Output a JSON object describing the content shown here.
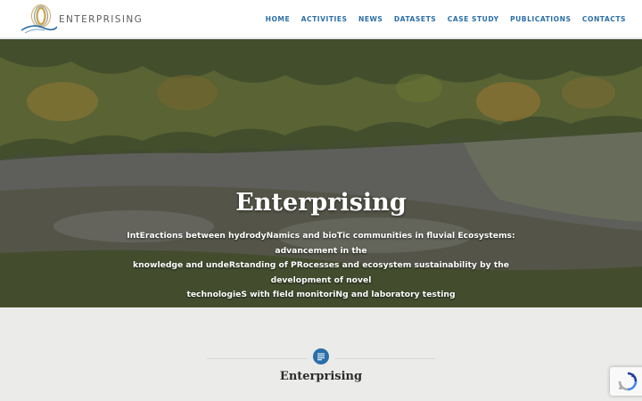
{
  "brand": {
    "name": "ENTERPRISING"
  },
  "nav": {
    "items": [
      {
        "label": "HOME"
      },
      {
        "label": "ACTIVITIES"
      },
      {
        "label": "NEWS"
      },
      {
        "label": "DATASETS"
      },
      {
        "label": "CASE STUDY"
      },
      {
        "label": "PUBLICATIONS"
      },
      {
        "label": "CONTACTS"
      }
    ]
  },
  "hero": {
    "title": "Enterprising",
    "subtitle_lines": [
      "IntEractions between hydrodyNamics and bioTic communities in fluvial Ecosystems: advancement in the",
      "knowledge and undeRstanding of PRocesses and ecosystem sustainability by the development of novel",
      "technologieS with fIeld monitoriNg and laboratory testing"
    ],
    "background_icon": "river-landscape-photo"
  },
  "section": {
    "icon": "text-lines-icon",
    "title": "Enterprising"
  },
  "recaptcha": {
    "icon": "recaptcha-icon"
  },
  "colors": {
    "accent": "#2a6fa8",
    "section_bg": "#ebebe9",
    "header_bg": "#ffffff"
  }
}
